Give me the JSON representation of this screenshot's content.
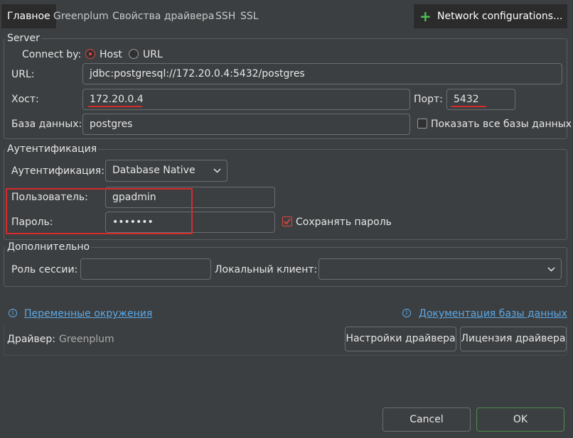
{
  "tabs": [
    {
      "label": "Главное"
    },
    {
      "label": "Greenplum"
    },
    {
      "label": "Свойства драйвера"
    },
    {
      "label": "SSH"
    },
    {
      "label": "SSL"
    }
  ],
  "network_config_label": "Network configurations...",
  "server": {
    "legend": "Server",
    "connect_by_label": "Connect by:",
    "connect_by_options": [
      "Host",
      "URL"
    ],
    "connect_by_selected": "Host",
    "url_label": "URL:",
    "url_value": "jdbc:postgresql://172.20.0.4:5432/postgres",
    "host_label": "Хост:",
    "host_value": "172.20.0.4",
    "port_label": "Порт:",
    "port_value": "5432",
    "database_label": "База данных:",
    "database_value": "postgres",
    "show_all_db_label": "Показать все базы данных",
    "show_all_db_checked": false
  },
  "auth": {
    "legend": "Аутентификация",
    "method_label": "Аутентификация:",
    "method_value": "Database Native",
    "user_label": "Пользователь:",
    "user_value": "gpadmin",
    "password_label": "Пароль:",
    "password_value": "•••••••",
    "save_password_label": "Сохранять пароль",
    "save_password_checked": true
  },
  "advanced": {
    "legend": "Дополнительно",
    "session_role_label": "Роль сессии:",
    "session_role_value": "",
    "local_client_label": "Локальный клиент:",
    "local_client_value": ""
  },
  "links": {
    "env_vars": "Переменные окружения",
    "db_docs": "Документация базы данных"
  },
  "driver": {
    "label": "Драйвер:",
    "name": "Greenplum",
    "settings_button": "Настройки драйвера",
    "license_button": "Лицензия драйвера"
  },
  "footer": {
    "cancel": "Cancel",
    "ok": "OK"
  },
  "colors": {
    "background": "#3c3f41",
    "accent_red": "#e0483e",
    "annotation_red": "#d62b2b",
    "link_blue": "#5ba8e6",
    "add_green": "#4fc24f"
  }
}
